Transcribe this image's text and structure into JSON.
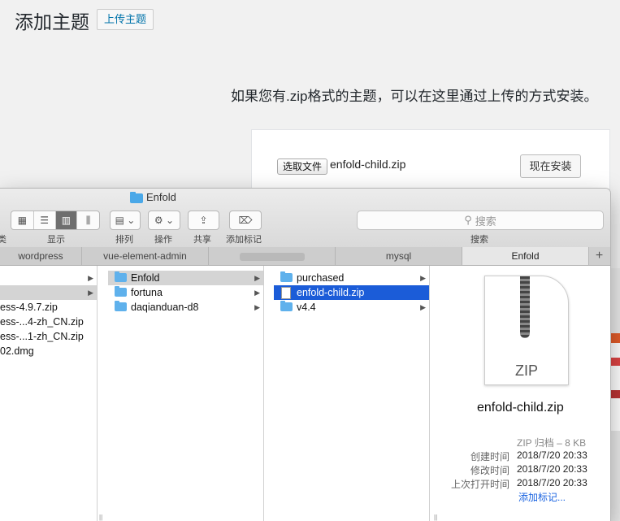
{
  "wp": {
    "page_title": "添加主题",
    "upload_button": "上传主题",
    "description": "如果您有.zip格式的主题，可以在这里通过上传的方式安装。",
    "choose_file": "选取文件",
    "chosen_file": "enfold-child.zip",
    "install_button": "现在安装"
  },
  "finder": {
    "window_title": "Enfold",
    "toolbar": {
      "display_label": "显示",
      "sort_label": "排列",
      "action_label": "操作",
      "share_label": "共享",
      "tag_label": "添加标记",
      "search_label": "搜索",
      "search_placeholder": "搜索",
      "left_cut_label": "类"
    },
    "tabs": [
      "wordpress",
      "vue-element-admin",
      "",
      "mysql",
      "Enfold"
    ],
    "tab_plus": "+",
    "col1": [
      {
        "label": "",
        "arrow": "▶"
      },
      {
        "label": "",
        "arrow": "▶"
      },
      {
        "label": "ess-4.9.7.zip",
        "arrow": ""
      },
      {
        "label": "ess-...4-zh_CN.zip",
        "arrow": ""
      },
      {
        "label": "ess-...1-zh_CN.zip",
        "arrow": ""
      },
      {
        "label": "02.dmg",
        "arrow": ""
      }
    ],
    "col2": [
      {
        "label": "Enfold",
        "arrow": "▶"
      },
      {
        "label": "fortuna",
        "arrow": "▶"
      },
      {
        "label": "daqianduan-d8",
        "arrow": "▶"
      }
    ],
    "col3": [
      {
        "label": "purchased",
        "arrow": "▶"
      },
      {
        "label": "enfold-child.zip",
        "arrow": ""
      },
      {
        "label": "v4.4",
        "arrow": "▶"
      }
    ],
    "preview": {
      "icon_label": "ZIP",
      "file_name": "enfold-child.zip",
      "kind": "ZIP 归档 – 8 KB",
      "created_label": "创建时间",
      "created": "2018/7/20 20:33",
      "modified_label": "修改时间",
      "modified": "2018/7/20 20:33",
      "opened_label": "上次打开时间",
      "opened": "2018/7/20 20:33",
      "add_tag": "添加标记..."
    }
  }
}
